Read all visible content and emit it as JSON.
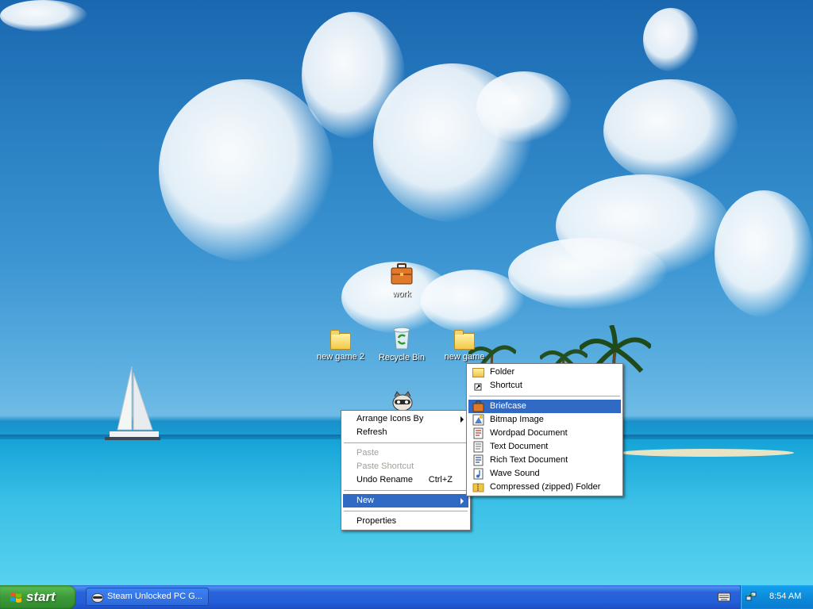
{
  "desktop": {
    "icons": [
      {
        "label": "work",
        "icon": "briefcase-icon"
      },
      {
        "label": "new game 2",
        "icon": "folder-icon"
      },
      {
        "label": "Recycle Bin",
        "icon": "recycle-bin-icon"
      },
      {
        "label": "new game",
        "icon": "folder-icon"
      }
    ]
  },
  "context_menu": {
    "items": [
      {
        "label": "Arrange Icons By",
        "submenu": true
      },
      {
        "label": "Refresh"
      },
      {
        "label": "Paste",
        "disabled": true
      },
      {
        "label": "Paste Shortcut",
        "disabled": true
      },
      {
        "label": "Undo Rename",
        "shortcut": "Ctrl+Z"
      },
      {
        "label": "New",
        "submenu": true,
        "highlighted": true
      },
      {
        "label": "Properties"
      }
    ]
  },
  "new_submenu": {
    "items": [
      {
        "label": "Folder",
        "icon": "folder-icon"
      },
      {
        "label": "Shortcut",
        "icon": "shortcut-icon"
      },
      {
        "label": "Briefcase",
        "icon": "briefcase-icon",
        "highlighted": true
      },
      {
        "label": "Bitmap Image",
        "icon": "bitmap-icon"
      },
      {
        "label": "Wordpad Document",
        "icon": "wordpad-icon"
      },
      {
        "label": "Text Document",
        "icon": "text-document-icon"
      },
      {
        "label": "Rich Text Document",
        "icon": "rich-text-icon"
      },
      {
        "label": "Wave Sound",
        "icon": "wave-sound-icon"
      },
      {
        "label": "Compressed (zipped) Folder",
        "icon": "zip-folder-icon"
      }
    ]
  },
  "taskbar": {
    "start_label": "start",
    "task_label": "Steam Unlocked PC G...",
    "clock": "8:54 AM"
  },
  "colors": {
    "highlight": "#316ac5",
    "taskbar": "#245edb",
    "start_button": "#3d9a3a",
    "tray": "#0d8bdb"
  }
}
